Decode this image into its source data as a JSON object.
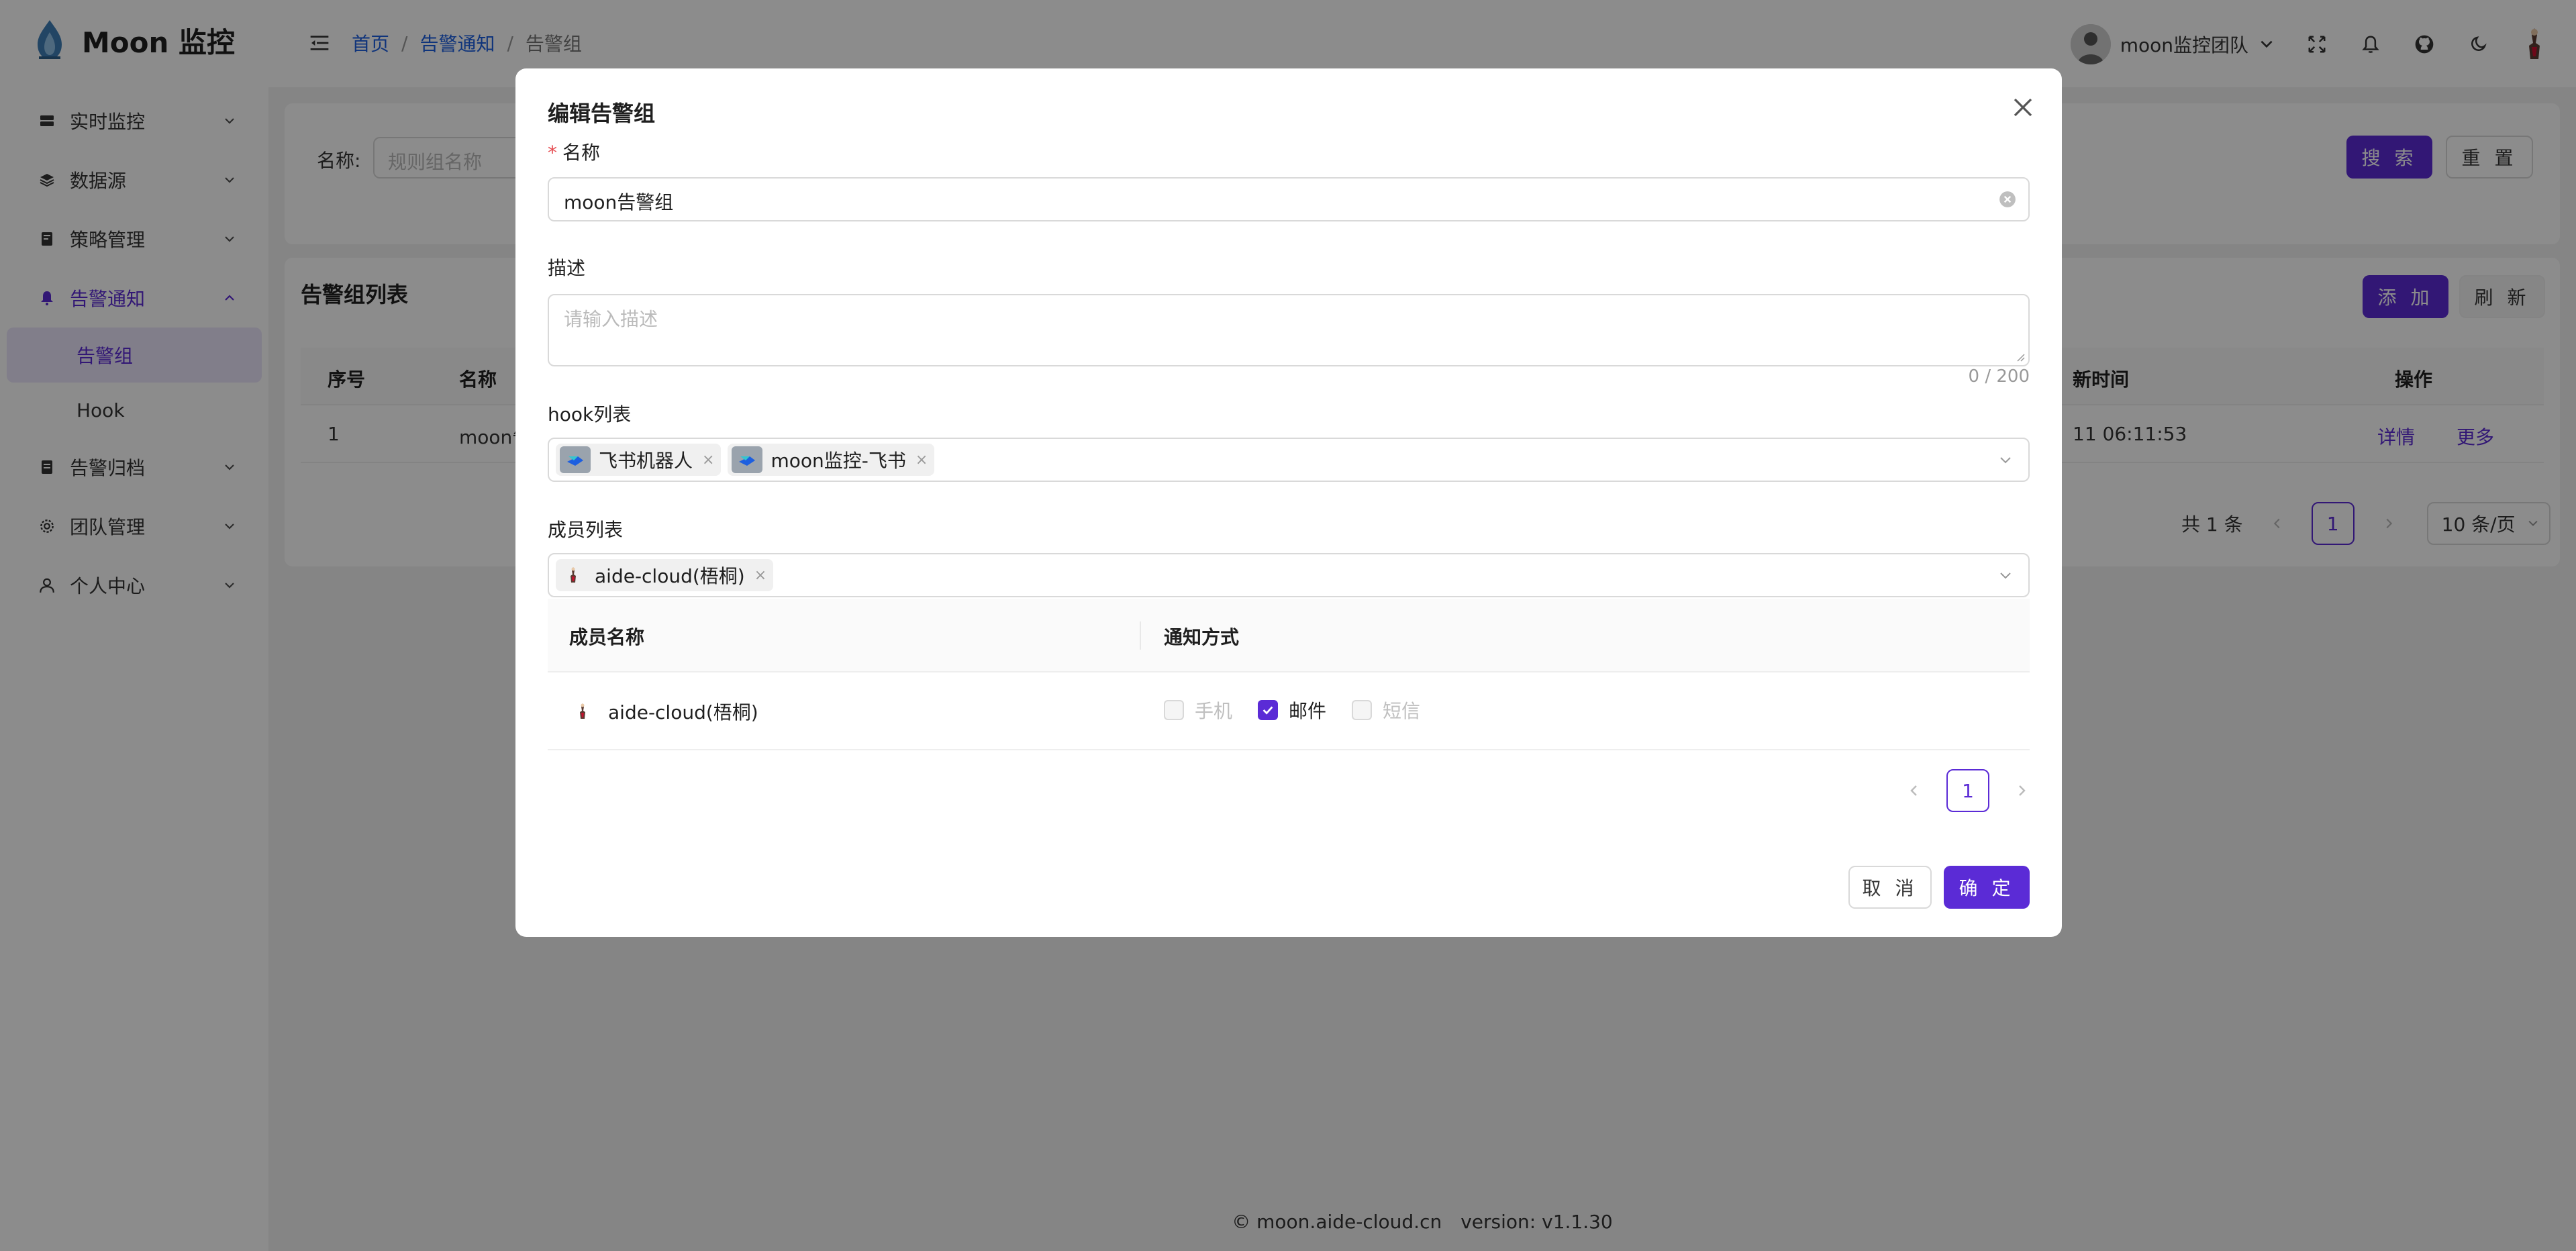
{
  "app": {
    "name": "Moon 监控"
  },
  "sidebar": {
    "items": [
      {
        "label": "实时监控",
        "icon": "monitor-icon"
      },
      {
        "label": "数据源",
        "icon": "database-icon"
      },
      {
        "label": "策略管理",
        "icon": "strategy-icon"
      },
      {
        "label": "告警通知",
        "icon": "bell-icon",
        "expanded": true,
        "children": [
          {
            "label": "告警组",
            "active": true
          },
          {
            "label": "Hook",
            "active": false
          }
        ]
      },
      {
        "label": "告警归档",
        "icon": "archive-icon"
      },
      {
        "label": "团队管理",
        "icon": "gear-icon"
      },
      {
        "label": "个人中心",
        "icon": "user-icon"
      }
    ]
  },
  "header": {
    "breadcrumb": [
      "首页",
      "告警通知",
      "告警组"
    ],
    "breadcrumb_sep": "/",
    "team_name": "moon监控团队"
  },
  "filter": {
    "name_label": "名称:",
    "name_placeholder": "规则组名称",
    "search_label": "搜 索",
    "reset_label": "重 置"
  },
  "list": {
    "title": "告警组列表",
    "add_label": "添 加",
    "refresh_label": "刷 新",
    "columns": {
      "index": "序号",
      "name": "名称",
      "updated": "新时间",
      "actions": "操作"
    },
    "rows": [
      {
        "index": "1",
        "name": "moon告警",
        "updated": "11 06:11:53",
        "detail": "详情",
        "more": "更多"
      }
    ],
    "total": "共 1 条",
    "page": "1",
    "page_size": "10 条/页"
  },
  "footer": {
    "site": "© moon.aide-cloud.cn",
    "version": "version: v1.1.30"
  },
  "modal": {
    "title": "编辑告警组",
    "name_label": "名称",
    "name_required_mark": "*",
    "name_value": "moon告警组",
    "desc_label": "描述",
    "desc_placeholder": "请输入描述",
    "desc_count": "0 / 200",
    "hook_label": "hook列表",
    "hooks": [
      "飞书机器人",
      "moon监控-飞书"
    ],
    "member_label": "成员列表",
    "members_selected": [
      "aide-cloud(梧桐)"
    ],
    "member_table": {
      "col_name": "成员名称",
      "col_notify": "通知方式",
      "rows": [
        {
          "name": "aide-cloud(梧桐)",
          "options": [
            {
              "label": "手机",
              "checked": false,
              "disabled": true
            },
            {
              "label": "邮件",
              "checked": true,
              "disabled": false
            },
            {
              "label": "短信",
              "checked": false,
              "disabled": true
            }
          ]
        }
      ]
    },
    "page": "1",
    "cancel_label": "取 消",
    "ok_label": "确 定"
  },
  "colors": {
    "primary": "#5b2bd6",
    "link": "#1d5fe0",
    "required": "#e5484d"
  }
}
